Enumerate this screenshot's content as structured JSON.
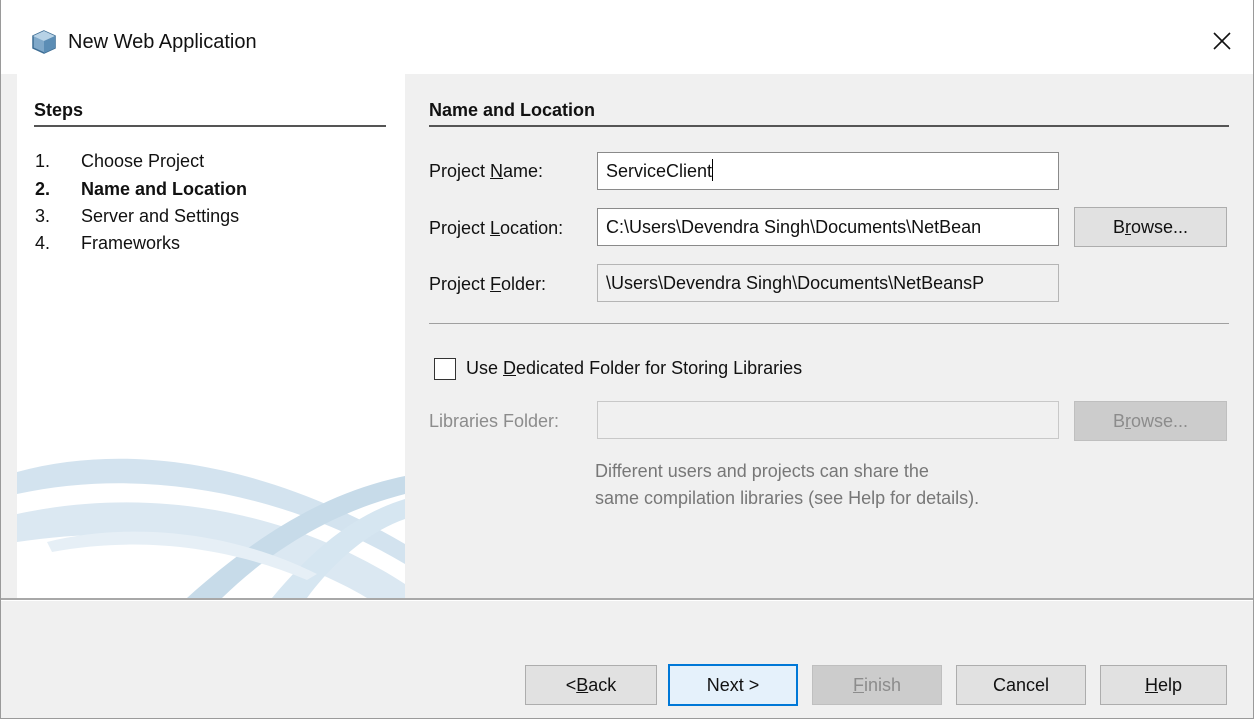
{
  "window": {
    "title": "New Web Application",
    "close_glyph": "✕"
  },
  "steps": {
    "header": "Steps",
    "items": [
      {
        "num": "1.",
        "label": "Choose Project",
        "current": false
      },
      {
        "num": "2.",
        "label": "Name and Location",
        "current": true
      },
      {
        "num": "3.",
        "label": "Server and Settings",
        "current": false
      },
      {
        "num": "4.",
        "label": "Frameworks",
        "current": false
      }
    ]
  },
  "form": {
    "section_title": "Name and Location",
    "project_name": {
      "label_pre": "Project ",
      "label_mnemonic": "N",
      "label_post": "ame:",
      "value": "ServiceClient"
    },
    "project_location": {
      "label_pre": "Project ",
      "label_mnemonic": "L",
      "label_post": "ocation:",
      "value": "C:\\Users\\Devendra Singh\\Documents\\NetBean"
    },
    "project_folder": {
      "label_pre": "Project ",
      "label_mnemonic": "F",
      "label_post": "older:",
      "value": "\\Users\\Devendra Singh\\Documents\\NetBeansP"
    },
    "browse_pre": "B",
    "browse_mnemonic": "r",
    "browse_post": "owse...",
    "dedicated_folder": {
      "label_pre": "Use ",
      "label_mnemonic": "D",
      "label_post": "edicated Folder for Storing Libraries",
      "checked": false
    },
    "libraries_folder": {
      "label": "Libraries Folder:",
      "value": ""
    },
    "libraries_browse_pre": "B",
    "libraries_browse_mnemonic": "r",
    "libraries_browse_post": "owse...",
    "hint_line1": "Different users and projects can share the",
    "hint_line2": "same compilation libraries (see Help for details)."
  },
  "footer": {
    "back_pre": "< ",
    "back_mnemonic": "B",
    "back_post": "ack",
    "next": "Next >",
    "finish_mnemonic": "F",
    "finish_post": "inish",
    "cancel": "Cancel",
    "help_mnemonic": "H",
    "help_post": "elp"
  },
  "colors": {
    "focus_border": "#0078d7",
    "swoosh": "#c9ddea"
  }
}
